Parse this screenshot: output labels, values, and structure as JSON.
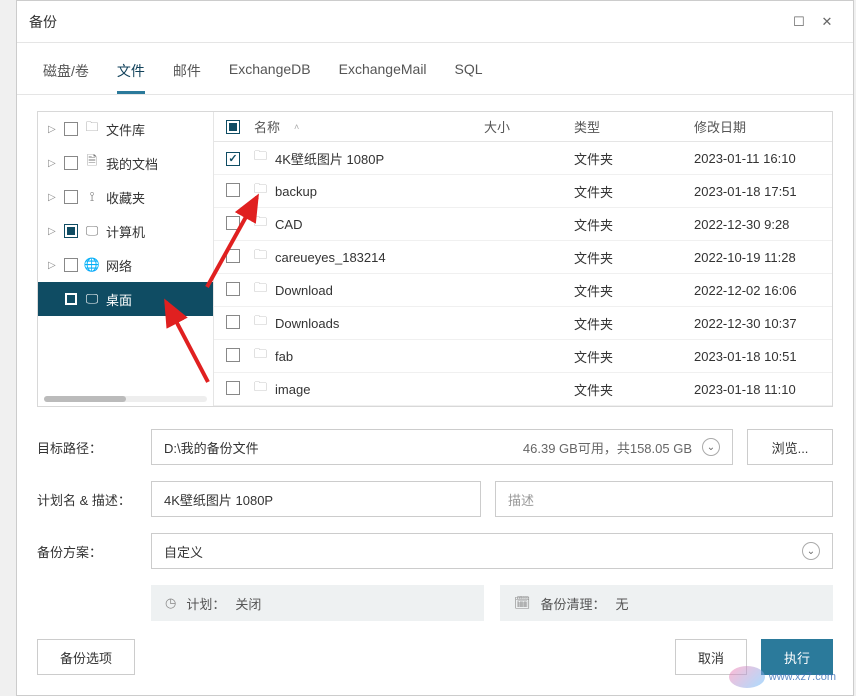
{
  "window": {
    "title": "备份"
  },
  "tabs": [
    {
      "label": "磁盘/卷",
      "active": false
    },
    {
      "label": "文件",
      "active": true
    },
    {
      "label": "邮件",
      "active": false
    },
    {
      "label": "ExchangeDB",
      "active": false
    },
    {
      "label": "ExchangeMail",
      "active": false
    },
    {
      "label": "SQL",
      "active": false
    }
  ],
  "tree": [
    {
      "label": "文件库",
      "icon": "folder",
      "expandable": true,
      "check": "none"
    },
    {
      "label": "我的文档",
      "icon": "doc",
      "expandable": true,
      "check": "none"
    },
    {
      "label": "收藏夹",
      "icon": "bookmark",
      "expandable": true,
      "check": "none"
    },
    {
      "label": "计算机",
      "icon": "monitor",
      "expandable": true,
      "check": "partial"
    },
    {
      "label": "网络",
      "icon": "globe",
      "expandable": true,
      "check": "none"
    },
    {
      "label": "桌面",
      "icon": "monitor",
      "expandable": false,
      "check": "partial",
      "selected": true
    }
  ],
  "columns": {
    "name": "名称",
    "size": "大小",
    "type": "类型",
    "date": "修改日期"
  },
  "files": [
    {
      "name": "4K壁纸图片 1080P",
      "type": "文件夹",
      "date": "2023-01-11 16:10",
      "checked": true
    },
    {
      "name": "backup",
      "type": "文件夹",
      "date": "2023-01-18 17:51",
      "checked": false
    },
    {
      "name": "CAD",
      "type": "文件夹",
      "date": "2022-12-30 9:28",
      "checked": false
    },
    {
      "name": "careueyes_183214",
      "type": "文件夹",
      "date": "2022-10-19 11:28",
      "checked": false
    },
    {
      "name": "Download",
      "type": "文件夹",
      "date": "2022-12-02 16:06",
      "checked": false
    },
    {
      "name": "Downloads",
      "type": "文件夹",
      "date": "2022-12-30 10:37",
      "checked": false
    },
    {
      "name": "fab",
      "type": "文件夹",
      "date": "2023-01-18 10:51",
      "checked": false
    },
    {
      "name": "image",
      "type": "文件夹",
      "date": "2023-01-18 11:10",
      "checked": false
    }
  ],
  "form": {
    "target_label": "目标路径：",
    "target_value": "D:\\我的备份文件",
    "target_hint": "46.39 GB可用，共158.05 GB",
    "browse": "浏览...",
    "plan_label": "计划名 & 描述：",
    "plan_value": "4K壁纸图片 1080P",
    "desc_placeholder": "描述",
    "scheme_label": "备份方案：",
    "scheme_value": "自定义",
    "schedule_label": "计划：",
    "schedule_value": "关闭",
    "cleanup_label": "备份清理：",
    "cleanup_value": "无"
  },
  "footer": {
    "options": "备份选项",
    "cancel": "取消",
    "execute": "执行"
  },
  "watermark": "www.xz7.com"
}
